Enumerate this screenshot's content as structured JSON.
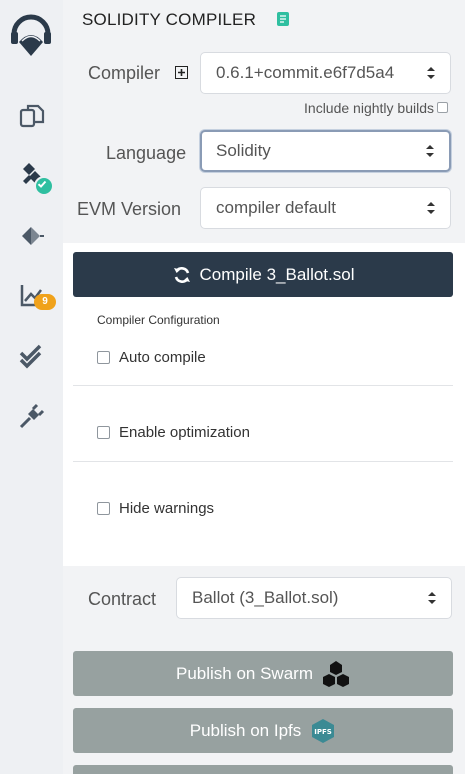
{
  "rail": {
    "icons": [
      "remix-logo-icon",
      "file-explorer-icon",
      "solidity-compiler-icon",
      "deploy-run-icon",
      "analysis-icon",
      "testing-icon",
      "plugin-manager-icon"
    ],
    "analysis_badge": "9",
    "colors": {
      "badge_ok": "#2fbfa0",
      "badge_count": "#f0a21b"
    }
  },
  "header": {
    "title": "SOLIDITY COMPILER"
  },
  "compiler": {
    "label": "Compiler",
    "version": "0.6.1+commit.e6f7d5a4",
    "nightly_label": "Include nightly builds"
  },
  "language": {
    "label": "Language",
    "value": "Solidity"
  },
  "evm": {
    "label": "EVM Version",
    "value": "compiler default"
  },
  "compile_button": {
    "label": "Compile 3_Ballot.sol"
  },
  "config": {
    "title": "Compiler Configuration",
    "auto_compile": "Auto compile",
    "enable_optimization": "Enable optimization",
    "hide_warnings": "Hide warnings"
  },
  "contract": {
    "label": "Contract",
    "value": "Ballot (3_Ballot.sol)"
  },
  "publish": {
    "swarm_label": "Publish on Swarm",
    "ipfs_label": "Publish on Ipfs",
    "ipfs_logo_text": "IPFS"
  },
  "colors": {
    "compile_bg": "#2b3a4a",
    "publish_bg": "#97a1a0",
    "accent": "#2fbfa0"
  }
}
